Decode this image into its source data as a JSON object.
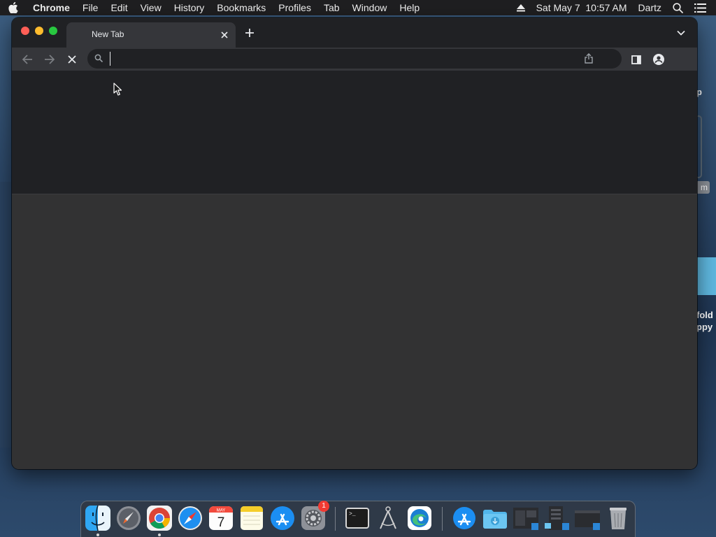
{
  "menubar": {
    "app_name": "Chrome",
    "items": [
      "File",
      "Edit",
      "View",
      "History",
      "Bookmarks",
      "Profiles",
      "Tab",
      "Window",
      "Help"
    ],
    "datetime": "Sat May 7  10:57 AM",
    "user": "Dartz"
  },
  "desktop_peek": {
    "line1": "p",
    "badge": "m",
    "line2": "fold",
    "line3": "ppy"
  },
  "browser": {
    "tab_title": "New Tab",
    "omnibox_value": "",
    "omnibox_placeholder": ""
  },
  "dock": {
    "badge_count": "1",
    "calendar_month": "MAY",
    "calendar_day": "7"
  },
  "colors": {
    "titlebar": "#202124",
    "toolbar": "#35363a",
    "content_body": "#323233",
    "close": "#ff5f57",
    "minimize": "#febc2e",
    "zoom": "#28c840"
  },
  "icons": [
    "apple-icon",
    "eject-icon",
    "spotlight-icon",
    "control-center-icon",
    "back-icon",
    "forward-icon",
    "stop-icon",
    "search-icon",
    "share-icon",
    "side-panel-icon",
    "profile-icon",
    "tab-close-icon",
    "new-tab-icon",
    "tab-search-icon"
  ]
}
